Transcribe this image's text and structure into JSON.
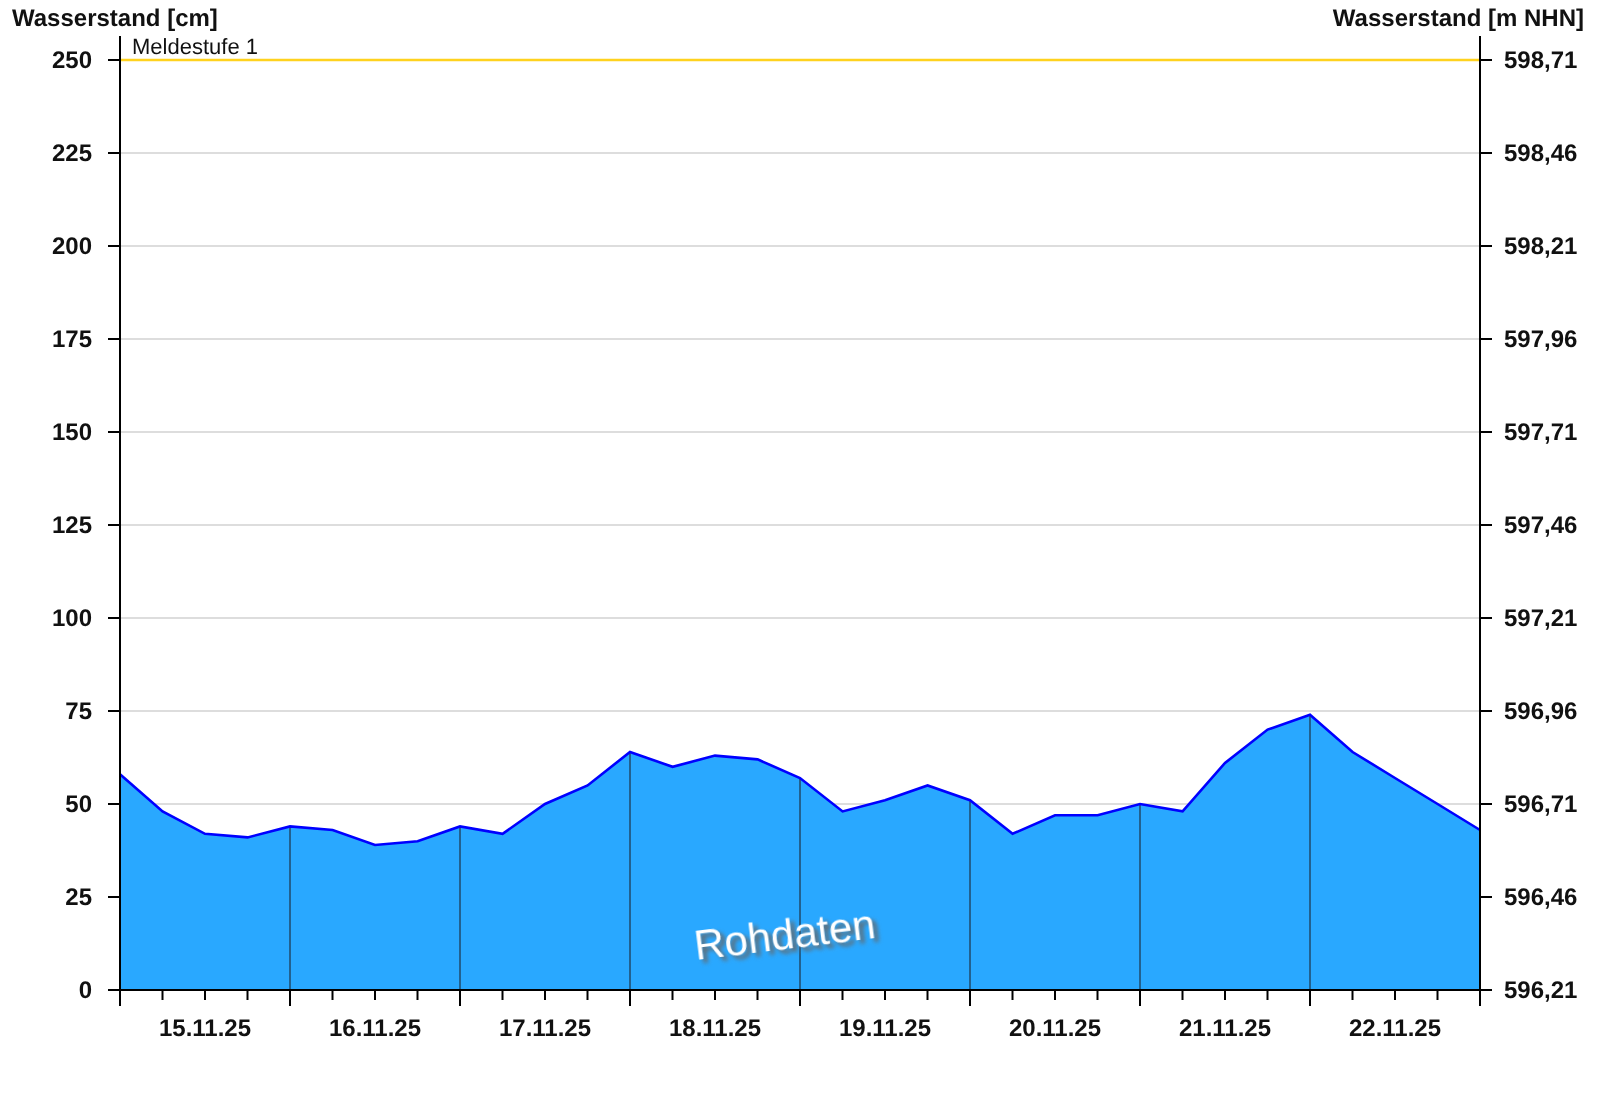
{
  "chart_data": {
    "type": "area",
    "ylabel": "Wasserstand [cm]",
    "y2label": "Wasserstand [m NHN]",
    "categories": [
      null,
      null,
      "15.11.25",
      null,
      null,
      null,
      "16.11.25",
      null,
      null,
      null,
      "17.11.25",
      null,
      null,
      null,
      "18.11.25",
      null,
      null,
      null,
      "19.11.25",
      null,
      null,
      null,
      "20.11.25",
      null,
      null,
      null,
      "21.11.25",
      null,
      null,
      null,
      "22.11.25",
      null,
      null
    ],
    "series": [
      {
        "name": "Rohdaten",
        "color": "#29a8ff",
        "values": [
          58,
          48,
          42,
          41,
          44,
          43,
          39,
          40,
          44,
          42,
          50,
          55,
          64,
          60,
          63,
          62,
          57,
          48,
          51,
          55,
          51,
          42,
          47,
          47,
          50,
          48,
          61,
          70,
          74,
          64,
          57,
          50,
          43
        ]
      }
    ],
    "ylim": [
      0,
      250
    ],
    "grid": true,
    "yticks": [
      0,
      25,
      50,
      75,
      100,
      125,
      150,
      175,
      200,
      225,
      250
    ],
    "y2lim": [
      596.21,
      598.71
    ],
    "y2ticks": [
      {
        "value": 596.21,
        "label": "596,21"
      },
      {
        "value": 596.46,
        "label": "596,46"
      },
      {
        "value": 596.71,
        "label": "596,71"
      },
      {
        "value": 596.96,
        "label": "596,96"
      },
      {
        "value": 597.21,
        "label": "597,21"
      },
      {
        "value": 597.46,
        "label": "597,46"
      },
      {
        "value": 597.71,
        "label": "597,71"
      },
      {
        "value": 597.96,
        "label": "597,96"
      },
      {
        "value": 598.21,
        "label": "598,21"
      },
      {
        "value": 598.46,
        "label": "598,46"
      },
      {
        "value": 598.71,
        "label": "598,71"
      }
    ],
    "ref_lines": [
      {
        "axis": "y",
        "value": 250,
        "label": "Meldestufe 1",
        "color": "#ffd21e"
      }
    ]
  }
}
